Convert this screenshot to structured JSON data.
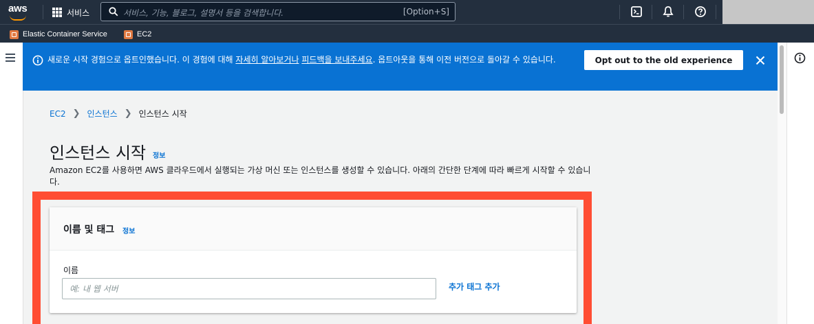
{
  "topnav": {
    "logo": "aws",
    "services_label": "서비스",
    "search_placeholder": "서비스, 기능, 블로그, 설명서 등을 검색합니다.",
    "search_shortcut": "[Option+S]",
    "icons": [
      "cloudshell-icon",
      "bell-icon",
      "help-icon"
    ]
  },
  "favorites": [
    {
      "label": "Elastic Container Service",
      "icon": "ecs-service-icon"
    },
    {
      "label": "EC2",
      "icon": "ec2-service-icon"
    }
  ],
  "banner": {
    "text_1": "새로운 시작 경험으로 옵트인했습니다. 이 경험에 대해 ",
    "link_1": "자세히 알아보거나",
    "text_2": " ",
    "link_2": "피드백을 보내주세요",
    "text_3": ". 옵트아웃을 통해 이전 버전으로 돌아갈 수 있습니다.",
    "optout_label": "Opt out to the old experience",
    "bg_color": "#0972d3"
  },
  "breadcrumb": [
    {
      "label": "EC2",
      "link": true
    },
    {
      "label": "인스턴스",
      "link": true
    },
    {
      "label": "인스턴스 시작",
      "link": false
    }
  ],
  "page": {
    "title": "인스턴스 시작",
    "info_label": "정보",
    "description": "Amazon EC2를 사용하면 AWS 클라우드에서 실행되는 가상 머신 또는 인스턴스를 생성할 수 있습니다. 아래의 간단한 단계에 따라 빠르게 시작할 수 있습니다."
  },
  "name_tags_panel": {
    "title": "이름 및 태그",
    "info_label": "정보",
    "field_label": "이름",
    "input_value": "",
    "input_placeholder": "예: 내 웹 서버",
    "add_tag_label": "추가 태그 추가"
  },
  "highlight_color": "#ff4d33"
}
